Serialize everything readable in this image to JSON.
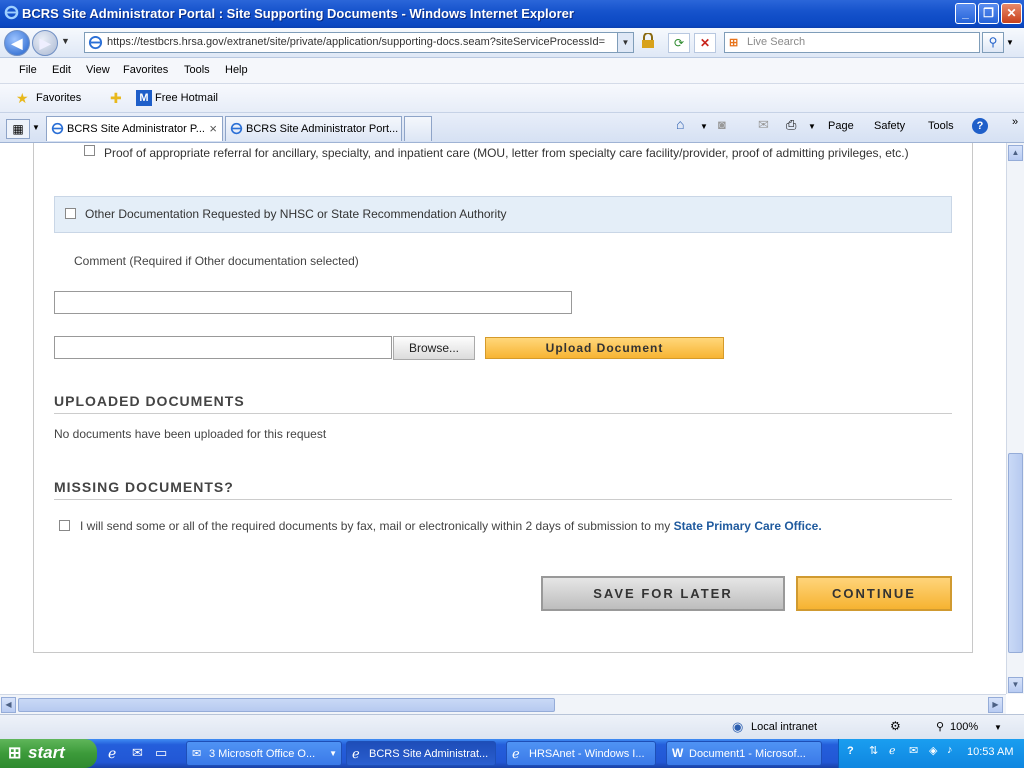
{
  "window": {
    "title": "BCRS Site Administrator Portal : Site Supporting Documents - Windows Internet Explorer"
  },
  "address": {
    "url": "https://testbcrs.hrsa.gov/extranet/site/private/application/supporting-docs.seam?siteServiceProcessId=",
    "search_placeholder": "Live Search"
  },
  "menu": [
    "File",
    "Edit",
    "View",
    "Favorites",
    "Tools",
    "Help"
  ],
  "favorites": {
    "label": "Favorites",
    "hotmail": "Free Hotmail"
  },
  "tabs": [
    {
      "label": "BCRS Site Administrator P...",
      "close": "×"
    },
    {
      "label": "BCRS Site Administrator Port..."
    }
  ],
  "commands": {
    "page": "Page",
    "safety": "Safety",
    "tools": "Tools"
  },
  "docs": {
    "referral": "Proof of appropriate referral for ancillary, specialty, and inpatient care (MOU, letter from specialty care facility/provider, proof of admitting privileges, etc.)",
    "other": "Other Documentation Requested by NHSC or State Recommendation Authority",
    "comment_label": "Comment (Required if Other documentation selected)",
    "browse": "Browse...",
    "upload": "Upload Document"
  },
  "uploaded": {
    "heading": "UPLOADED DOCUMENTS",
    "empty": "No documents have been uploaded for this request"
  },
  "missing": {
    "heading": "MISSING DOCUMENTS?",
    "statement": "I will send some or all of the required documents by fax, mail or electronically within 2 days of submission to my",
    "link": "State Primary Care Office."
  },
  "actions": {
    "save": "SAVE FOR LATER",
    "continue": "CONTINUE"
  },
  "status": {
    "zone": "Local intranet",
    "zoom": "100%"
  },
  "taskbar": {
    "start": "start",
    "items": [
      "3 Microsoft Office O...",
      "BCRS Site Administrat...",
      "HRSAnet - Windows I...",
      "Document1 - Microsof..."
    ],
    "clock": "10:53 AM"
  },
  "colors": {
    "accent": "#f7b433",
    "link": "#1f5a9e",
    "title_bar": "#0a47c2",
    "row_highlight": "#e4eef8"
  }
}
